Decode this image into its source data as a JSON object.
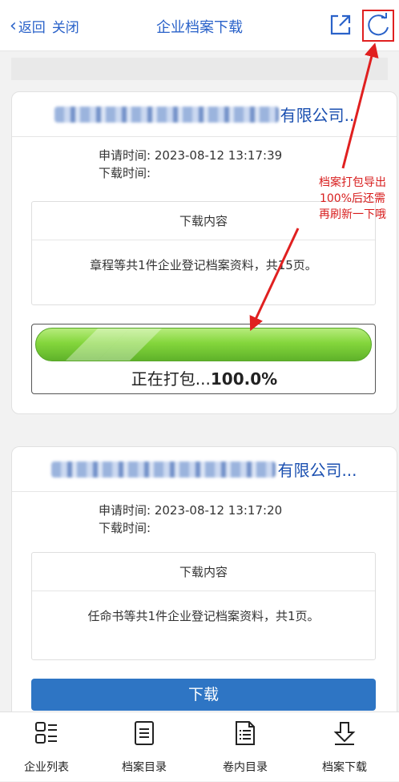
{
  "header": {
    "back_label": "返回",
    "close_label": "关闭",
    "title": "企业档案下载",
    "export_icon": "external-link-icon",
    "refresh_icon": "refresh-icon"
  },
  "records": [
    {
      "company_suffix": "有限公司..",
      "apply_time_label": "申请时间:",
      "apply_time": "2023-08-12 13:17:39",
      "download_time_label": "下载时间:",
      "content_header": "下载内容",
      "content_text": "章程等共1件企业登记档案资料，共15页。",
      "progress_label": "正在打包...",
      "progress_value": "100.0%",
      "progress_fraction": 1.0
    },
    {
      "company_suffix": "有限公司...",
      "apply_time_label": "申请时间:",
      "apply_time": "2023-08-12 13:17:20",
      "download_time_label": "下载时间:",
      "content_header": "下载内容",
      "content_text": "任命书等共1件企业登记档案资料，共1页。",
      "download_button": "下载"
    }
  ],
  "annotation": {
    "text_lines": [
      "档案打包导出",
      "100%后还需",
      "再刷新一下哦"
    ],
    "color": "#d81e1e"
  },
  "tabbar": [
    {
      "label": "企业列表",
      "icon": "company-list-icon"
    },
    {
      "label": "档案目录",
      "icon": "archive-catalog-icon"
    },
    {
      "label": "卷内目录",
      "icon": "volume-catalog-icon"
    },
    {
      "label": "档案下载",
      "icon": "download-icon"
    }
  ],
  "colors": {
    "accent": "#2a62c9",
    "button": "#2e75c4",
    "progress": "#84d63c",
    "highlight": "#e02020"
  }
}
